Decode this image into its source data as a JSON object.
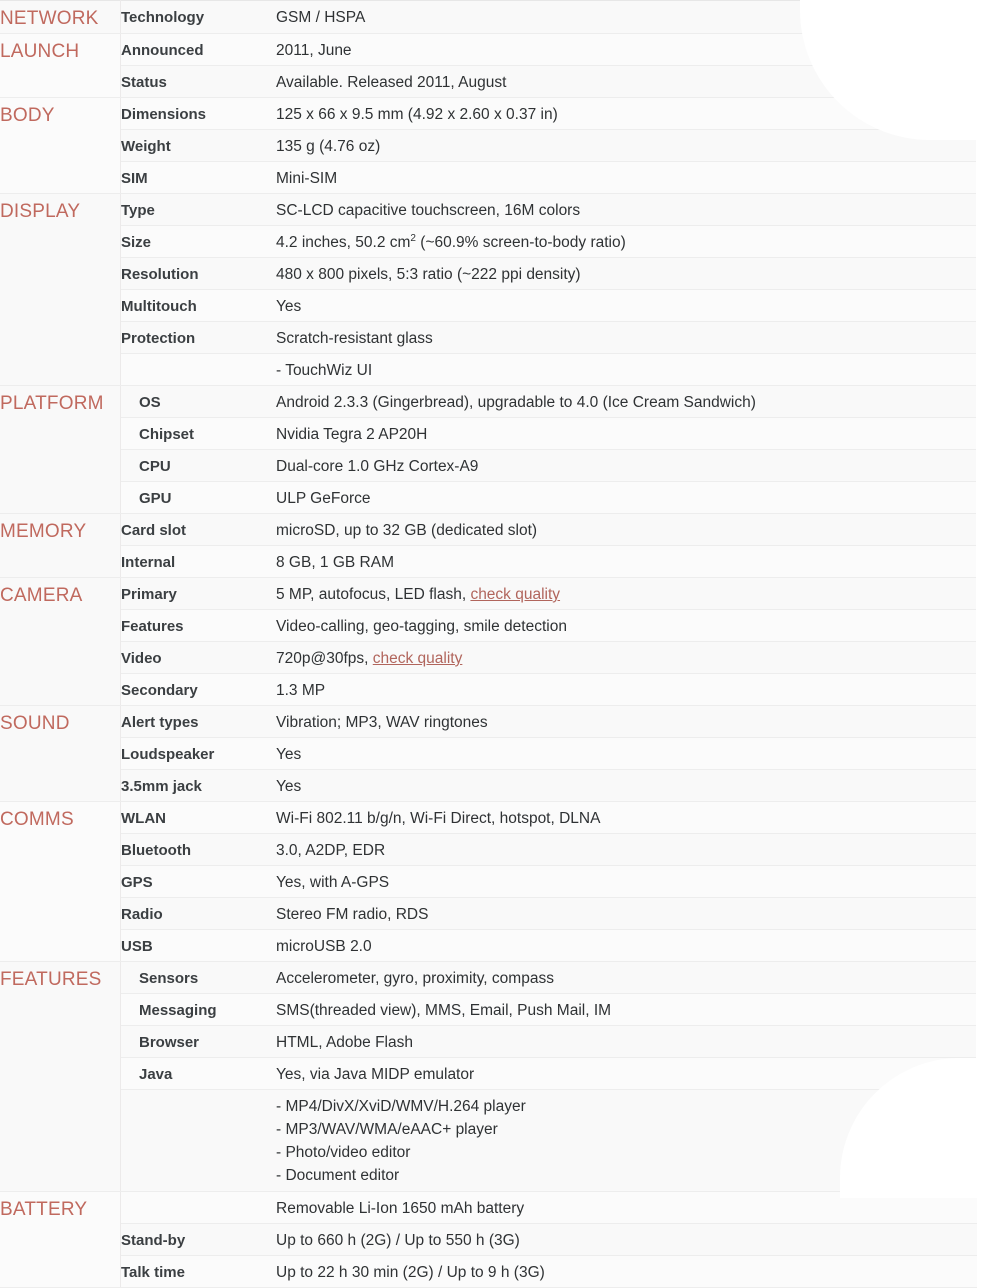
{
  "sheet": {
    "title": "Phone specifications table",
    "accent_category_color": "#c0695e",
    "link_color": "#b1655c",
    "row_bg": "#f9f9f9",
    "row_border": "#ededed"
  },
  "sections": [
    {
      "category": "NETWORK",
      "indent": false,
      "rows": [
        {
          "label": "Technology",
          "value": "GSM / HSPA"
        }
      ]
    },
    {
      "category": "LAUNCH",
      "indent": false,
      "rows": [
        {
          "label": "Announced",
          "value": "2011, June"
        },
        {
          "label": "Status",
          "value": "Available. Released 2011, August"
        }
      ]
    },
    {
      "category": "BODY",
      "indent": false,
      "rows": [
        {
          "label": "Dimensions",
          "value": "125 x 66 x 9.5 mm (4.92 x 2.60 x 0.37 in)"
        },
        {
          "label": "Weight",
          "value": "135 g (4.76 oz)"
        },
        {
          "label": "SIM",
          "value": "Mini-SIM"
        }
      ]
    },
    {
      "category": "DISPLAY",
      "indent": false,
      "rows": [
        {
          "label": "Type",
          "value": "SC-LCD capacitive touchscreen, 16M colors"
        },
        {
          "label": "Size",
          "value": "4.2 inches, 50.2 cm2 (~60.9% screen-to-body ratio)",
          "value_parts": [
            "4.2 inches, 50.2 cm",
            "2",
            " (~60.9% screen-to-body ratio)"
          ]
        },
        {
          "label": "Resolution",
          "value": "480 x 800 pixels, 5:3 ratio (~222 ppi density)"
        },
        {
          "label": "Multitouch",
          "value": "Yes"
        },
        {
          "label": "Protection",
          "value": "Scratch-resistant glass"
        },
        {
          "label": "",
          "value": "- TouchWiz UI"
        }
      ]
    },
    {
      "category": "PLATFORM",
      "indent": true,
      "rows": [
        {
          "label": "OS",
          "value": "Android 2.3.3 (Gingerbread), upgradable to 4.0 (Ice Cream Sandwich)"
        },
        {
          "label": "Chipset",
          "value": "Nvidia Tegra 2 AP20H"
        },
        {
          "label": "CPU",
          "value": "Dual-core 1.0 GHz Cortex-A9"
        },
        {
          "label": "GPU",
          "value": "ULP GeForce"
        }
      ]
    },
    {
      "category": "MEMORY",
      "indent": false,
      "rows": [
        {
          "label": "Card slot",
          "value": "microSD, up to 32 GB (dedicated slot)"
        },
        {
          "label": "Internal",
          "value": "8 GB, 1 GB RAM"
        }
      ]
    },
    {
      "category": "CAMERA",
      "indent": false,
      "rows": [
        {
          "label": "Primary",
          "value": "5 MP, autofocus, LED flash, check quality",
          "value_prefix": "5 MP, autofocus, LED flash, ",
          "link": "check quality"
        },
        {
          "label": "Features",
          "value": "Video-calling, geo-tagging, smile detection"
        },
        {
          "label": "Video",
          "value": "720p@30fps, check quality",
          "value_prefix": "720p@30fps, ",
          "link": "check quality"
        },
        {
          "label": "Secondary",
          "value": "1.3 MP"
        }
      ]
    },
    {
      "category": "SOUND",
      "indent": false,
      "rows": [
        {
          "label": "Alert types",
          "value": "Vibration; MP3, WAV ringtones"
        },
        {
          "label": "Loudspeaker",
          "value": "Yes"
        },
        {
          "label": "3.5mm jack",
          "value": "Yes"
        }
      ]
    },
    {
      "category": "COMMS",
      "indent": false,
      "rows": [
        {
          "label": "WLAN",
          "value": "Wi-Fi 802.11 b/g/n, Wi-Fi Direct, hotspot, DLNA"
        },
        {
          "label": "Bluetooth",
          "value": "3.0, A2DP, EDR"
        },
        {
          "label": "GPS",
          "value": "Yes, with A-GPS"
        },
        {
          "label": "Radio",
          "value": "Stereo FM radio, RDS"
        },
        {
          "label": "USB",
          "value": "microUSB 2.0"
        }
      ]
    },
    {
      "category": "FEATURES",
      "indent": true,
      "rows": [
        {
          "label": "Sensors",
          "value": "Accelerometer, gyro, proximity, compass"
        },
        {
          "label": "Messaging",
          "value": "SMS(threaded view), MMS, Email, Push Mail, IM"
        },
        {
          "label": "Browser",
          "value": "HTML, Adobe Flash"
        },
        {
          "label": "Java",
          "value": "Yes, via Java MIDP emulator"
        },
        {
          "label": "",
          "lines": [
            "- MP4/DivX/XviD/WMV/H.264 player",
            "- MP3/WAV/WMA/eAAC+ player",
            "- Photo/video editor",
            "- Document editor"
          ]
        }
      ]
    },
    {
      "category": "BATTERY",
      "indent": false,
      "rows": [
        {
          "label": "",
          "value": "Removable Li-Ion 1650 mAh battery"
        },
        {
          "label": "Stand-by",
          "value": "Up to 660 h (2G) / Up to 550 h (3G)"
        },
        {
          "label": "Talk time",
          "value": "Up to 22 h 30 min (2G) / Up to 9 h (3G)"
        }
      ]
    }
  ]
}
